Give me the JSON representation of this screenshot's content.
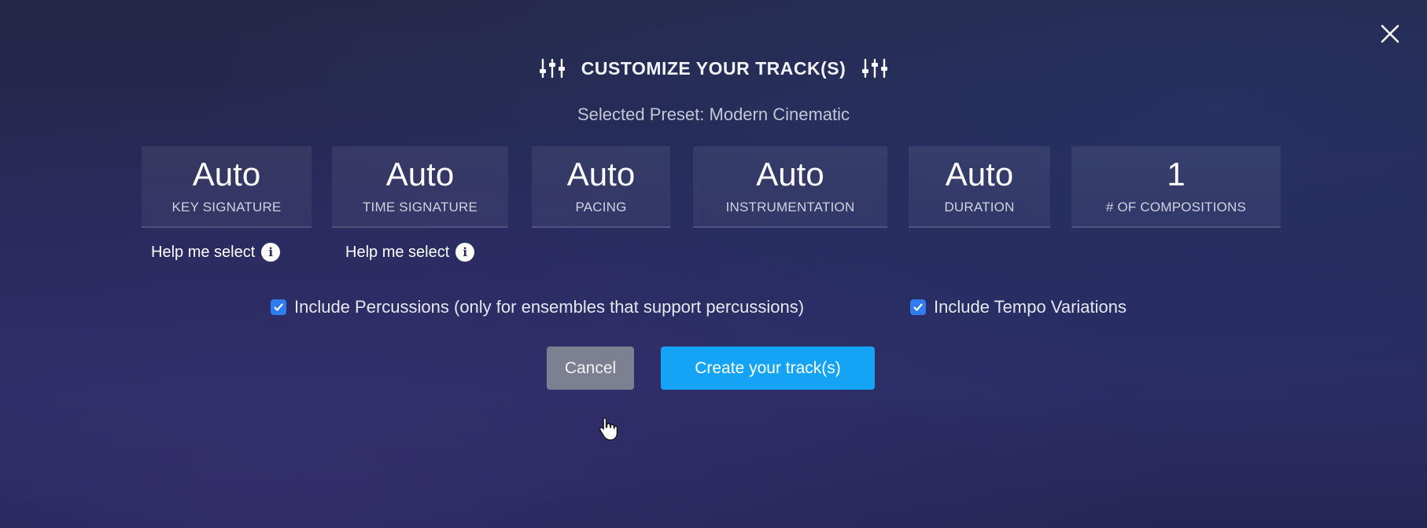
{
  "dialog": {
    "title": "CUSTOMIZE YOUR TRACK(S)",
    "preset_label": "Selected Preset: Modern Cinematic",
    "close_icon": "close-icon",
    "title_icon": "sliders-icon"
  },
  "settings": [
    {
      "value": "Auto",
      "label": "KEY SIGNATURE"
    },
    {
      "value": "Auto",
      "label": "TIME SIGNATURE"
    },
    {
      "value": "Auto",
      "label": "PACING"
    },
    {
      "value": "Auto",
      "label": "INSTRUMENTATION"
    },
    {
      "value": "Auto",
      "label": "DURATION"
    },
    {
      "value": "1",
      "label": "# OF COMPOSITIONS"
    }
  ],
  "help": [
    {
      "label": "Help me select",
      "icon": "info-icon"
    },
    {
      "label": "Help me select",
      "icon": "info-icon"
    }
  ],
  "options": [
    {
      "label": "Include Percussions (only for ensembles that support percussions)",
      "checked": true
    },
    {
      "label": "Include Tempo Variations",
      "checked": true
    }
  ],
  "buttons": {
    "cancel": "Cancel",
    "create": "Create your track(s)"
  },
  "colors": {
    "accent": "#14a3f5",
    "checkbox": "#2f7cf0",
    "cancel_bg": "#7d8090",
    "background": "#26295a"
  }
}
